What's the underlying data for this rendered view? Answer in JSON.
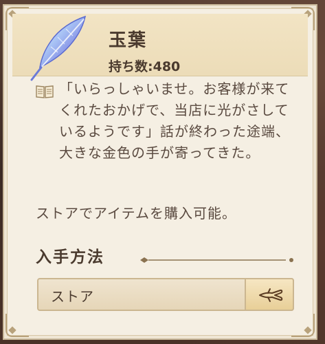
{
  "item": {
    "name": "玉葉",
    "quantity_label": "持ち数:480",
    "icon": "feather-crystal-icon"
  },
  "description": "「いらっしゃいませ。お客様が来てくれたおかげで、当店に光がさしているようです」話が終わった途端、大きな金色の手が寄ってきた。",
  "availability": "ストアでアイテムを購入可能。",
  "acquisition": {
    "title": "入手方法",
    "sources": [
      {
        "label": "ストア",
        "go_icon": "hand-pointer-icon"
      }
    ]
  },
  "colors": {
    "panel_bg": "#f5efe3",
    "header_bg": "#ecdcb8",
    "text": "#4a3a2e",
    "border": "#cbb690"
  }
}
